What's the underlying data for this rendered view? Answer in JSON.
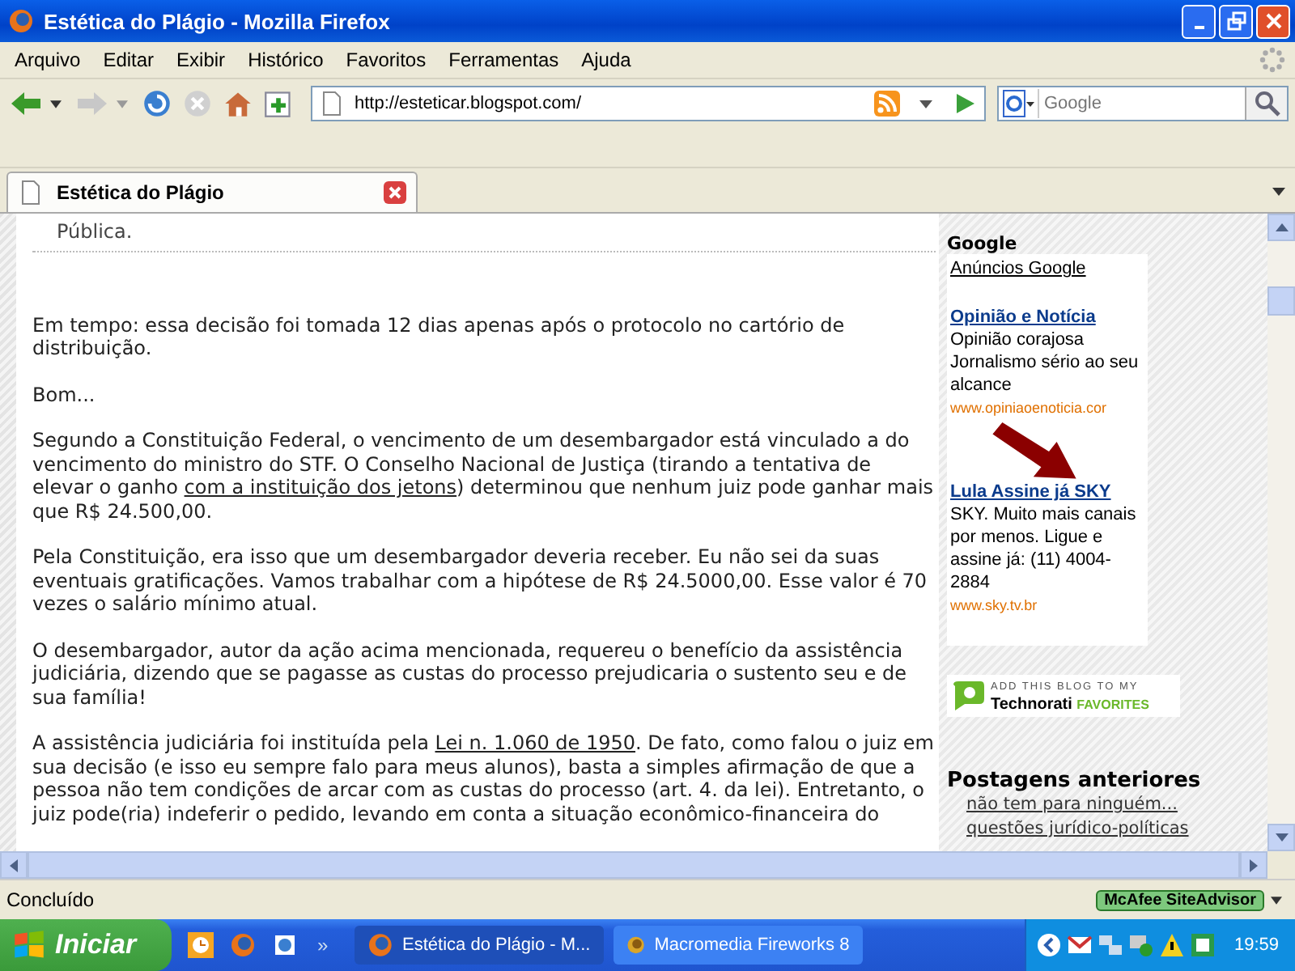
{
  "window": {
    "title": "Estética do Plágio - Mozilla Firefox"
  },
  "menu": [
    "Arquivo",
    "Editar",
    "Exibir",
    "Histórico",
    "Favoritos",
    "Ferramentas",
    "Ajuda"
  ],
  "address": {
    "value": "http://esteticar.blogspot.com/"
  },
  "search": {
    "placeholder": "Google"
  },
  "tabs": [
    {
      "label": "Estética do Plágio",
      "selected": true
    }
  ],
  "post": {
    "top_fragment": "Pública.",
    "paragraphs": [
      [
        {
          "kind": "text",
          "text": "Em tempo: essa decisão foi tomada 12 dias apenas após o protocolo no cartório de distribuição."
        }
      ],
      [
        {
          "kind": "text",
          "text": "Bom..."
        }
      ],
      [
        {
          "kind": "text",
          "text": "Segundo a Constituição Federal, o vencimento de um desembargador está vinculado a do vencimento do ministro do STF. O Conselho Nacional de Justiça (tirando a tentativa de elevar o ganho "
        },
        {
          "kind": "link",
          "text": "com a instituição dos jetons"
        },
        {
          "kind": "text",
          "text": ") determinou que nenhum juiz pode ganhar mais que R$ 24.500,00."
        }
      ],
      [
        {
          "kind": "text",
          "text": "Pela Constituição, era isso que um desembargador deveria receber. Eu não sei da suas eventuais gratificações. Vamos trabalhar com a hipótese de R$ 24.5000,00. Esse valor é 70 vezes o salário mínimo atual."
        }
      ],
      [
        {
          "kind": "text",
          "text": "O desembargador, autor da ação acima mencionada, requereu o benefício da assistência judiciária, dizendo que se pagasse as custas do processo prejudicaria o sustento seu e de sua família!"
        }
      ],
      [
        {
          "kind": "text",
          "text": "A assistência judiciária foi instituída pela "
        },
        {
          "kind": "link",
          "text": "Lei n. 1.060 de 1950"
        },
        {
          "kind": "text",
          "text": ". De fato, como falou o juiz em sua decisão (e isso eu sempre falo para meus alunos), basta a simples afirmação de que a pessoa não tem condições de arcar com as custas do processo (art. 4. da lei). Entretanto, o juiz pode(ria) indeferir o pedido, levando em conta a situação econômico-financeira do"
        }
      ]
    ]
  },
  "sidebar": {
    "ads_heading": "Google",
    "ads_link": "Anúncios Google",
    "ads": [
      {
        "title": "Opinião e Notícia",
        "body": "Opinião corajosa Jornalismo sério ao seu alcance",
        "url": "www.opiniaoenoticia.cor"
      },
      {
        "title": "Lula Assine já SKY",
        "body": "SKY. Muito mais canais por menos. Ligue e assine já: (11) 4004-2884",
        "url": "www.sky.tv.br"
      }
    ],
    "badge": {
      "top": "ADD THIS BLOG TO MY",
      "brand": "Technorati",
      "word": "FAVORITES"
    },
    "archive_heading": "Postagens anteriores",
    "archive": [
      "não tem para ninguém...",
      "questões jurídico-políticas"
    ]
  },
  "status_bar": {
    "text": "Concluído",
    "addon": "McAfee SiteAdvisor"
  },
  "taskbar": {
    "start": "Iniciar",
    "more": "»",
    "tasks": [
      {
        "label": "Estética do Plágio - M...",
        "selected": true
      },
      {
        "label": "Macromedia Fireworks 8",
        "selected": false
      }
    ],
    "time": "19:59"
  }
}
